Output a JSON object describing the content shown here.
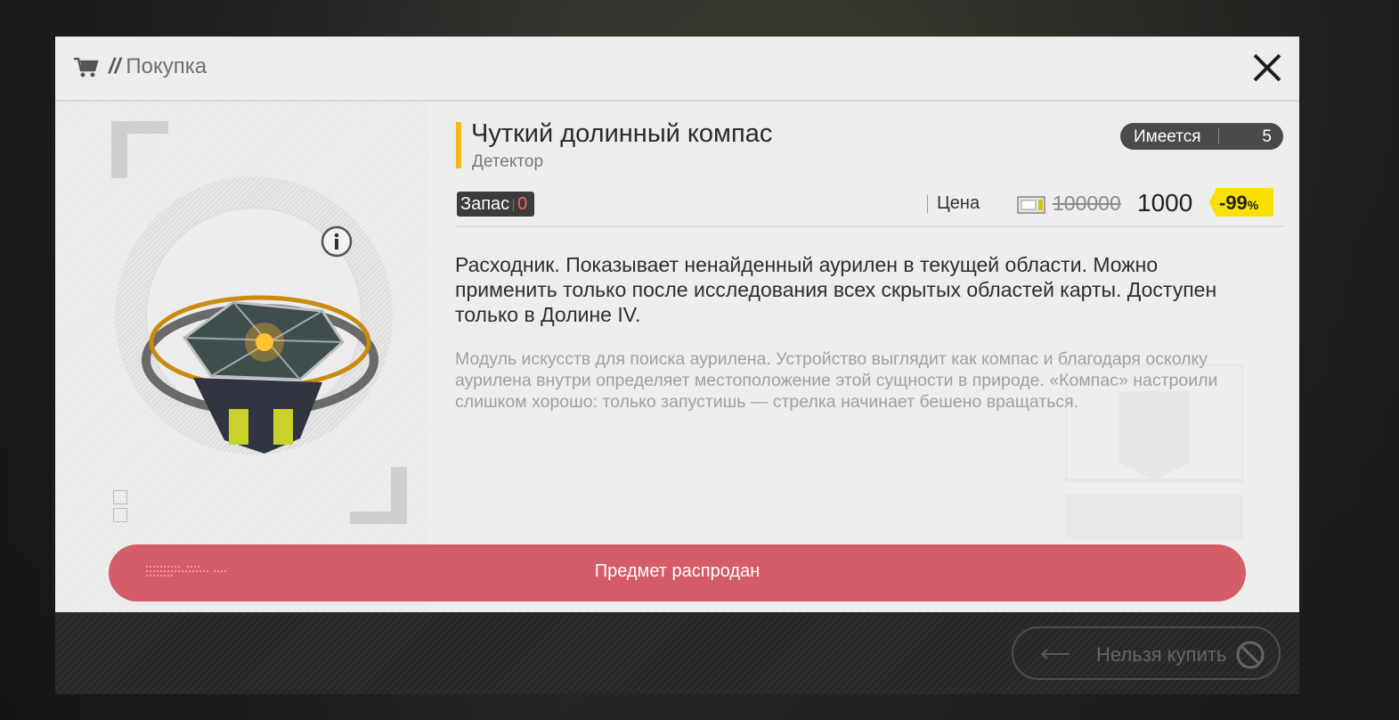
{
  "dialog": {
    "title": "Покупка",
    "title_prefix": "//",
    "icons": {
      "cart": "shopping-cart-icon",
      "close": "close-icon"
    }
  },
  "item": {
    "name": "Чуткий долинный компас",
    "type": "Детектор",
    "owned_label": "Имеется",
    "owned_value": "5",
    "stock_label": "Запас",
    "stock_value": "0",
    "price_label": "Цена",
    "old_price": "100000",
    "new_price": "1000",
    "discount": "-99",
    "discount_unit": "%",
    "description": "Расходник. Показывает ненайденный аурилен в текущей области. Можно применить только после исследования всех скрытых областей карты. Доступен только в Долине IV.",
    "flavor_text": "Модуль искусств для поиска аурилена. Устройство выглядит как компас и благодаря осколку аурилена внутри определяет местоположение этой сущности в природе. «Компас» настроили слишком хорошо: только запустишь — стрелка начинает бешено вращаться."
  },
  "buttons": {
    "sold_out": "Предмет распродан",
    "cant_buy": "Нельзя купить"
  },
  "colors": {
    "accent_yellow": "#f3b716",
    "sold_out_red": "#d45c66",
    "stock_zero_red": "#ff6060",
    "discount_yellow": "#f8e000"
  }
}
